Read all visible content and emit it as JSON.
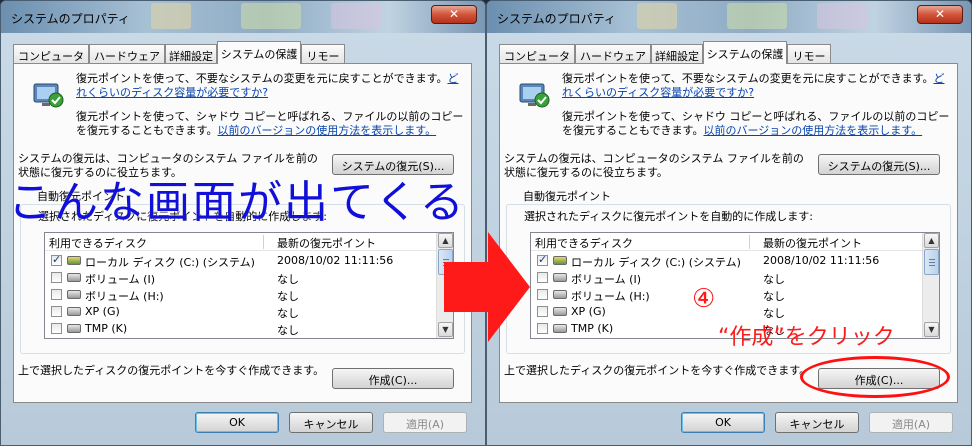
{
  "dialog": {
    "title": "システムのプロパティ",
    "close_symbol": "✕",
    "tabs": [
      "コンピュータ名",
      "ハードウェア",
      "詳細設定",
      "システムの保護",
      "リモート"
    ],
    "active_tab": "システムの保護",
    "intro1_text": "復元ポイントを使って、不要なシステムの変更を元に戻すことができます。",
    "intro1_link": "どれくらいのディスク容量が必要ですか?",
    "intro2_text": "復元ポイントを使って、シャドウ コピーと呼ばれる、ファイルの以前のコピーを復元することもできます。",
    "intro2_link": "以前のバージョンの使用方法を表示します。",
    "restore_desc": "システムの復元は、コンピュータのシステム ファイルを前の状態に復元するのに役立ちます。",
    "restore_button": "システムの復元(S)...",
    "auto_group_label": "自動復元ポイント",
    "auto_desc": "選択されたディスクに復元ポイントを自動的に作成します:",
    "list": {
      "col_disk": "利用できるディスク",
      "col_latest": "最新の復元ポイント",
      "rows": [
        {
          "name": "ローカル ディスク (C:) (システム)",
          "date": "2008/10/02 11:11:56",
          "checked": true
        },
        {
          "name": "ボリューム (I)",
          "date": "なし",
          "checked": false
        },
        {
          "name": "ボリューム (H:)",
          "date": "なし",
          "checked": false
        },
        {
          "name": "XP (G)",
          "date": "なし",
          "checked": false
        },
        {
          "name": "TMP (K)",
          "date": "なし",
          "checked": false
        }
      ]
    },
    "create_desc": "上で選択したディスクの復元ポイントを今すぐ作成できます。",
    "create_button": "作成(C)...",
    "ok_button": "OK",
    "cancel_button": "キャンセル",
    "apply_button": "適用(A)"
  },
  "annotations": {
    "overlay_text": "こんな画面が出てくる",
    "step_number": "④",
    "step_instruction": "“作成”をクリック",
    "accent_color": "#ff1a1a",
    "overlay_color": "#1010d8"
  }
}
